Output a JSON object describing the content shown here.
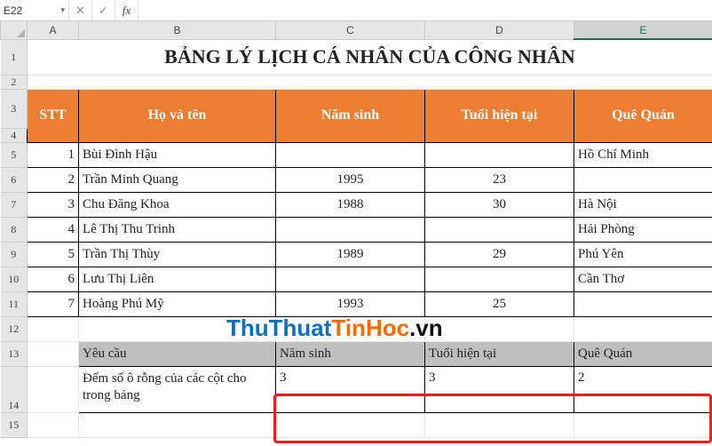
{
  "namebox": {
    "value": "E22"
  },
  "fx_label": "fx",
  "icons": {
    "cancel": "✕",
    "confirm": "✓",
    "dropdown": "▾"
  },
  "columns": [
    "A",
    "B",
    "C",
    "D",
    "E"
  ],
  "rows": [
    "1",
    "2",
    "3",
    "4",
    "5",
    "6",
    "7",
    "8",
    "9",
    "10",
    "11",
    "12",
    "13",
    "14",
    "15"
  ],
  "title": "BẢNG LÝ LỊCH CÁ NHÂN CỦA CÔNG NHÂN",
  "headers": {
    "stt": "STT",
    "hoten": "Họ và tên",
    "namsinh": "Năm sinh",
    "tuoi": "Tuổi hiện tại",
    "quequan": "Quê Quán"
  },
  "records": [
    {
      "stt": "1",
      "hoten": "Bùi Đình Hậu",
      "namsinh": "",
      "tuoi": "",
      "quequan": "Hồ Chí Minh"
    },
    {
      "stt": "2",
      "hoten": "Trần Minh Quang",
      "namsinh": "1995",
      "tuoi": "23",
      "quequan": ""
    },
    {
      "stt": "3",
      "hoten": "Chu Đăng Khoa",
      "namsinh": "1988",
      "tuoi": "30",
      "quequan": "Hà Nội"
    },
    {
      "stt": "4",
      "hoten": "Lê Thị Thu Trinh",
      "namsinh": "",
      "tuoi": "",
      "quequan": "Hải Phòng"
    },
    {
      "stt": "5",
      "hoten": "Trần Thị Thùy",
      "namsinh": "1989",
      "tuoi": "29",
      "quequan": "Phú Yên"
    },
    {
      "stt": "6",
      "hoten": "Lưu Thị Liên",
      "namsinh": "",
      "tuoi": "",
      "quequan": "Cần Thơ"
    },
    {
      "stt": "7",
      "hoten": "Hoàng Phú Mỹ",
      "namsinh": "1993",
      "tuoi": "25",
      "quequan": ""
    }
  ],
  "summary": {
    "label_yeucau": "Yêu cầu",
    "label_namsinh": "Năm sinh",
    "label_tuoi": "Tuổi hiện tại",
    "label_quequan": "Quê Quán",
    "desc": "Đếm số ô rỗng của các cột cho trong bảng",
    "count_namsinh": "3",
    "count_tuoi": "3",
    "count_quequan": "2"
  },
  "watermark": {
    "p1": "ThuThuat",
    "p2": "TinHoc",
    "p3": ".vn"
  },
  "chart_data": {
    "type": "table",
    "title": "BẢNG LÝ LỊCH CÁ NHÂN CỦA CÔNG NHÂN",
    "columns": [
      "STT",
      "Họ và tên",
      "Năm sinh",
      "Tuổi hiện tại",
      "Quê Quán"
    ],
    "rows": [
      [
        1,
        "Bùi Đình Hậu",
        null,
        null,
        "Hồ Chí Minh"
      ],
      [
        2,
        "Trần Minh Quang",
        1995,
        23,
        null
      ],
      [
        3,
        "Chu Đăng Khoa",
        1988,
        30,
        "Hà Nội"
      ],
      [
        4,
        "Lê Thị Thu Trinh",
        null,
        null,
        "Hải Phòng"
      ],
      [
        5,
        "Trần Thị Thùy",
        1989,
        29,
        "Phú Yên"
      ],
      [
        6,
        "Lưu Thị Liên",
        null,
        null,
        "Cần Thơ"
      ],
      [
        7,
        "Hoàng Phú Mỹ",
        1993,
        25,
        null
      ]
    ],
    "summary_counts_blank": {
      "Năm sinh": 3,
      "Tuổi hiện tại": 3,
      "Quê Quán": 2
    }
  }
}
